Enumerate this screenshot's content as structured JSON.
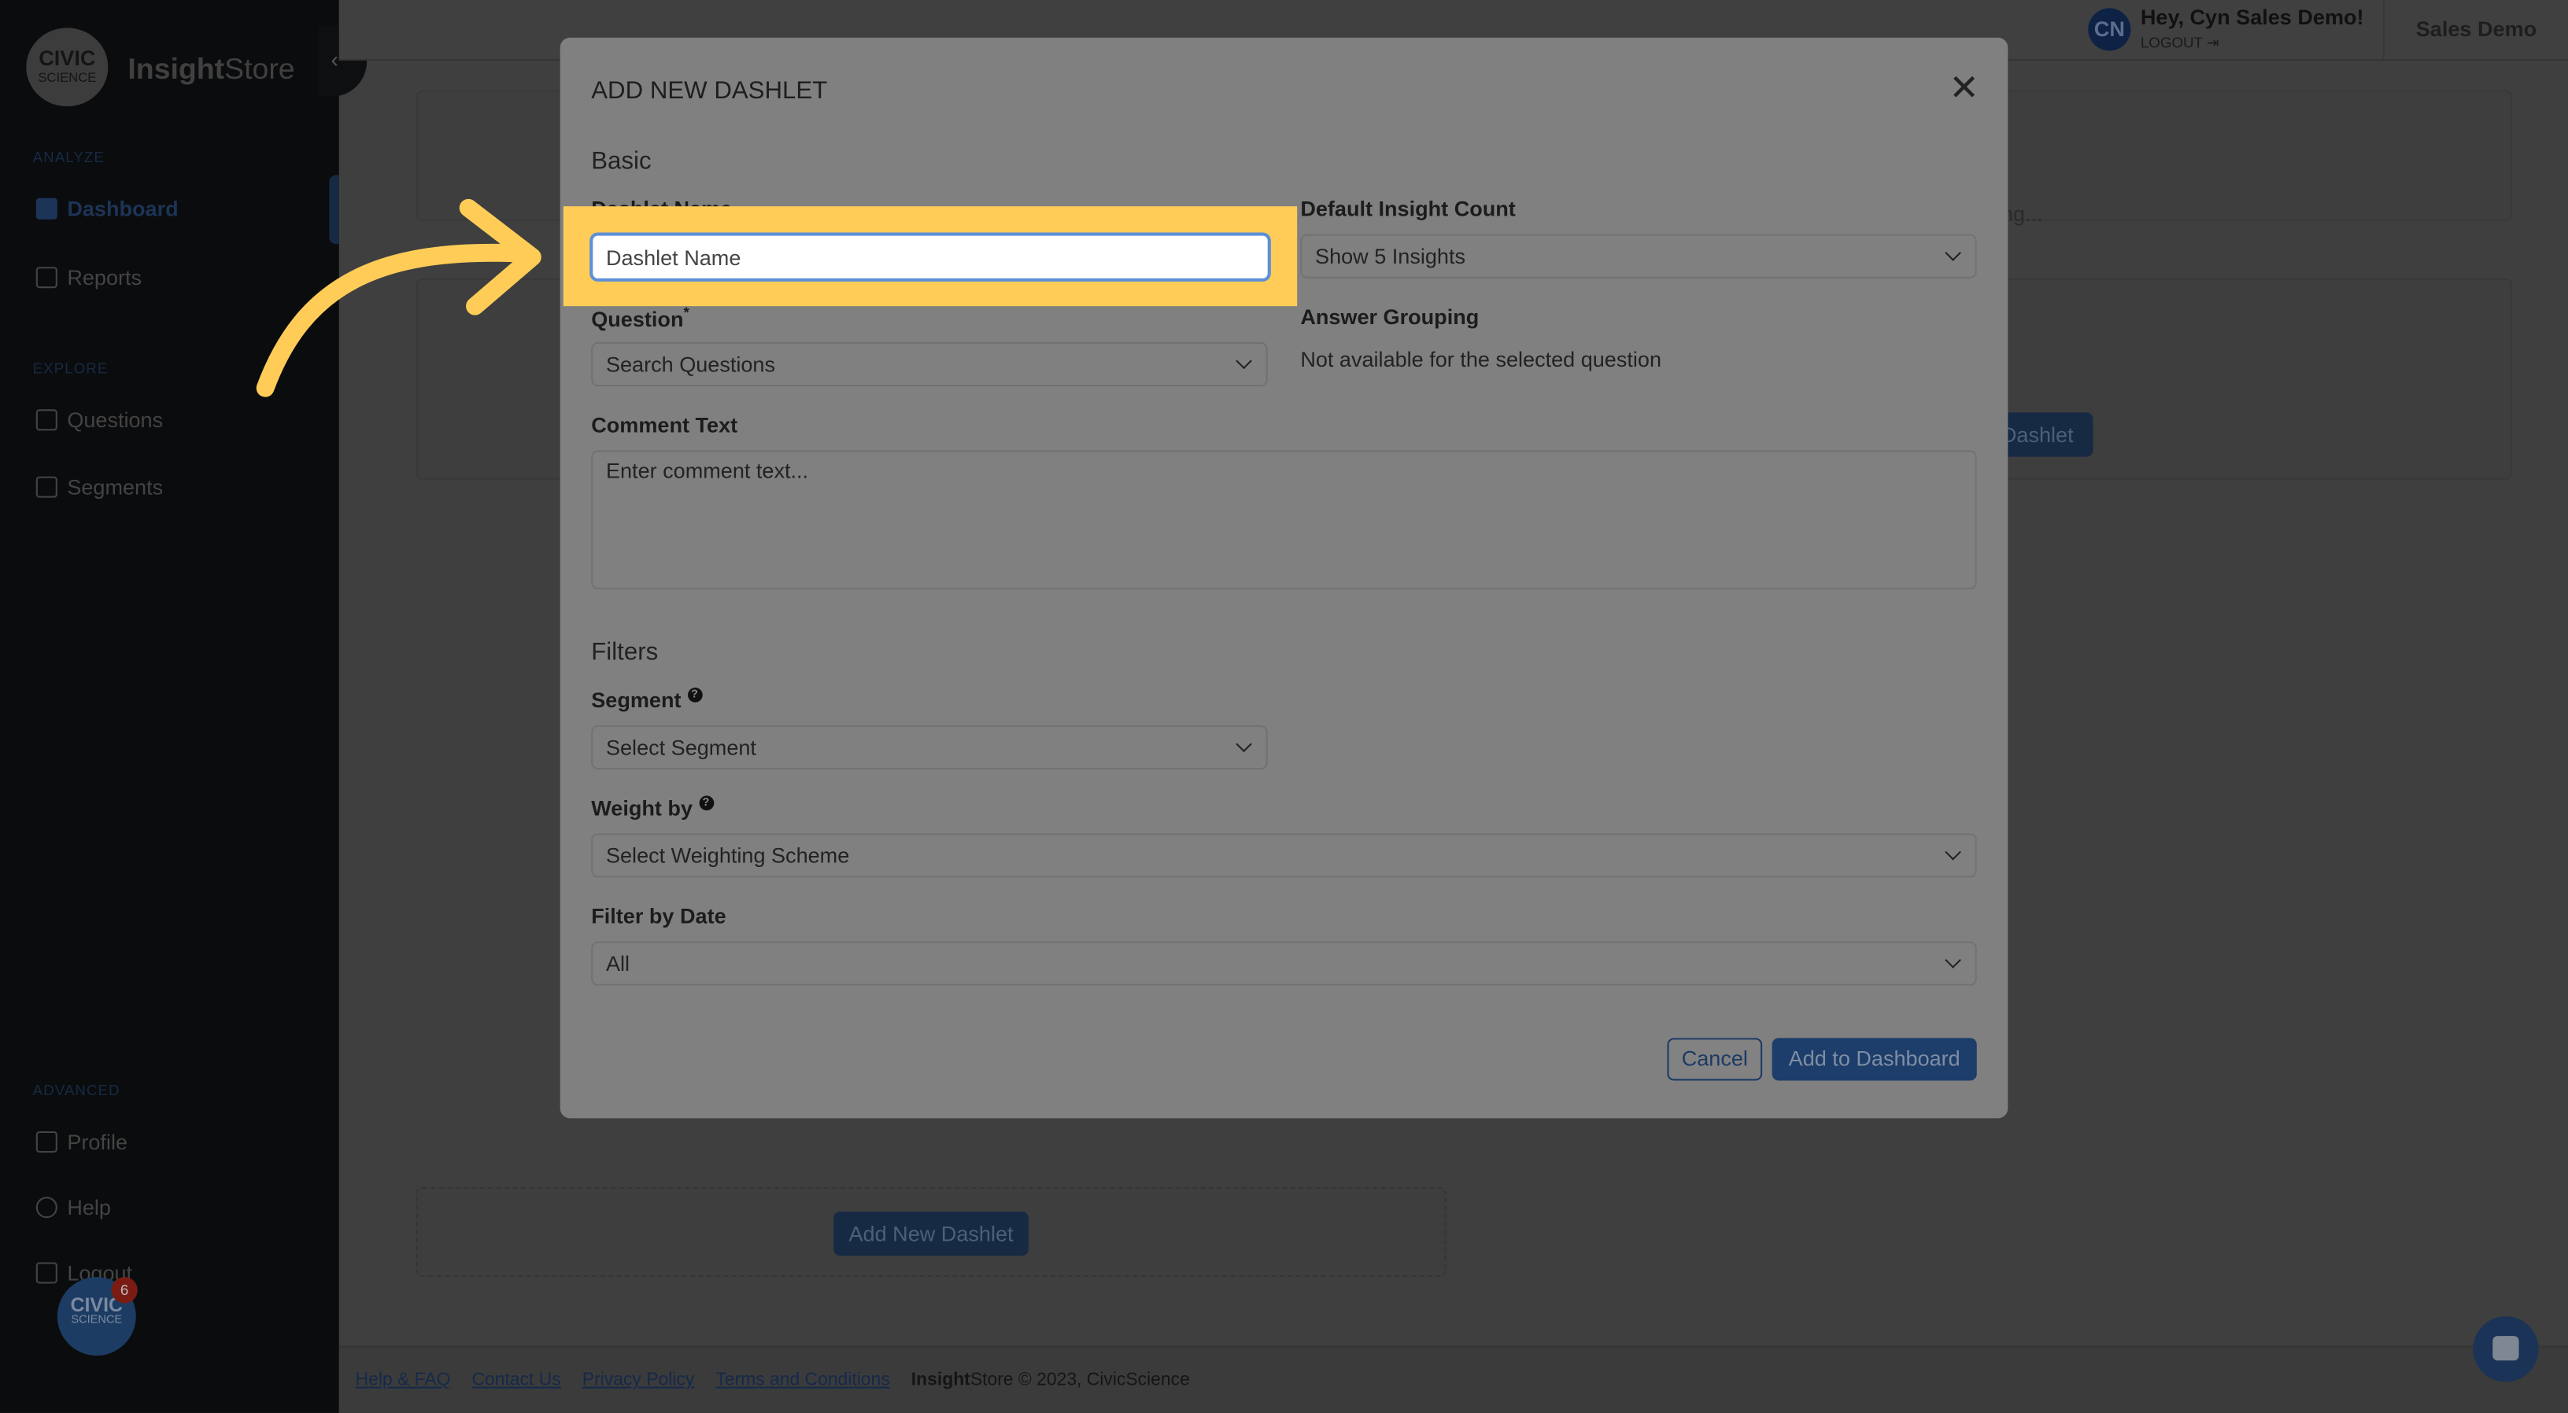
{
  "sidebar": {
    "logo_text": "CIVIC SCIENCE",
    "brand_bold": "Insight",
    "brand_rest": "Store",
    "sections": {
      "analyze": "ANALYZE",
      "explore": "EXPLORE",
      "advanced": "ADVANCED"
    },
    "items": [
      {
        "label": "Dashboard",
        "icon": "dashboard-icon",
        "active": true
      },
      {
        "label": "Reports",
        "icon": "report-icon"
      },
      {
        "label": "Questions",
        "icon": "question-icon"
      },
      {
        "label": "Segments",
        "icon": "segments-icon"
      },
      {
        "label": "Profile",
        "icon": "profile-icon"
      },
      {
        "label": "Help",
        "icon": "lifebuoy-icon"
      },
      {
        "label": "Logout",
        "icon": "logout-icon"
      }
    ],
    "chat_badge": {
      "text1": "CIVIC",
      "text2": "SCIENCE",
      "count": "6"
    }
  },
  "topbar": {
    "avatar": "CN",
    "greeting": "Hey, Cyn Sales Demo!",
    "logout": "LOGOUT",
    "account": "Sales Demo"
  },
  "background": {
    "loading": "ng...",
    "dashlet_button": "Dashlet",
    "add_new_dashlet": "Add New Dashlet"
  },
  "footer": {
    "links": [
      "Help & FAQ",
      "Contact Us",
      "Privacy Policy",
      "Terms and Conditions"
    ],
    "copy_bold": "Insight",
    "copy_rest": "Store © 2023, CivicScience"
  },
  "modal": {
    "title": "ADD NEW DASHLET",
    "basic": "Basic",
    "dashlet_name_label": "Dashlet Name",
    "dashlet_name_placeholder": "Dashlet Name",
    "insight_count_label": "Default Insight Count",
    "insight_count_value": "Show 5 Insights",
    "question_label": "Question",
    "question_placeholder": "Search Questions",
    "answer_grouping_label": "Answer Grouping",
    "answer_grouping_value": "Not available for the selected question",
    "comment_label": "Comment Text",
    "comment_placeholder": "Enter comment text...",
    "filters": "Filters",
    "segment_label": "Segment",
    "segment_placeholder": "Select Segment",
    "weight_label": "Weight by",
    "weight_placeholder": "Select Weighting Scheme",
    "date_label": "Filter by Date",
    "date_value": "All",
    "cancel": "Cancel",
    "add": "Add to Dashboard"
  },
  "colors": {
    "highlight": "#ffcd57",
    "primary": "#1d3d6a",
    "focus": "#5e90d8"
  }
}
